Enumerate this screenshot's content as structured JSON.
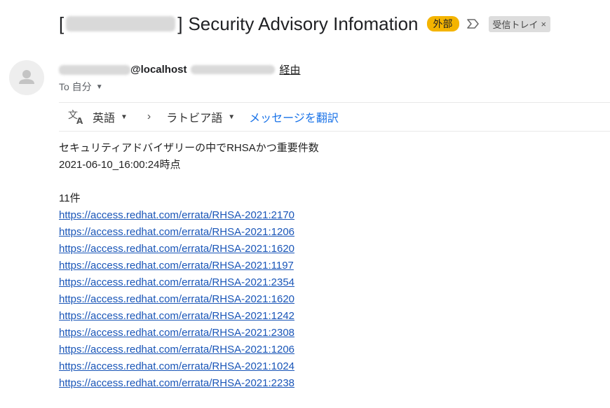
{
  "subject": {
    "bracket_open": "[",
    "bracket_close": "]",
    "title": "Security Advisory Infomation",
    "external_badge": "外部",
    "label_chip": "受信トレイ",
    "label_remove": "×"
  },
  "sender": {
    "host": "@localhost",
    "via": "経由",
    "to_label": "To 自分",
    "icons": [
      "avatar-person-icon",
      "important-marker-icon",
      "chevron-down-icon"
    ]
  },
  "translate": {
    "source_lang": "英語",
    "target_lang": "ラトビア語",
    "translate_link": "メッセージを翻訳",
    "icons": [
      "translate-icon",
      "chevron-right-icon"
    ]
  },
  "body": {
    "intro": "セキュリティアドバイザリーの中でRHSAかつ重要件数",
    "timestamp": "2021-06-10_16:00:24時点",
    "count": "11件",
    "links": [
      "https://access.redhat.com/errata/RHSA-2021:2170",
      "https://access.redhat.com/errata/RHSA-2021:1206",
      "https://access.redhat.com/errata/RHSA-2021:1620",
      "https://access.redhat.com/errata/RHSA-2021:1197",
      "https://access.redhat.com/errata/RHSA-2021:2354",
      "https://access.redhat.com/errata/RHSA-2021:1620",
      "https://access.redhat.com/errata/RHSA-2021:1242",
      "https://access.redhat.com/errata/RHSA-2021:2308",
      "https://access.redhat.com/errata/RHSA-2021:1206",
      "https://access.redhat.com/errata/RHSA-2021:1024",
      "https://access.redhat.com/errata/RHSA-2021:2238"
    ]
  },
  "colors": {
    "external_badge_bg": "#f4b400",
    "link": "#1a56b8",
    "translate_link": "#1a73e8",
    "label_chip_bg": "#dddddd"
  }
}
